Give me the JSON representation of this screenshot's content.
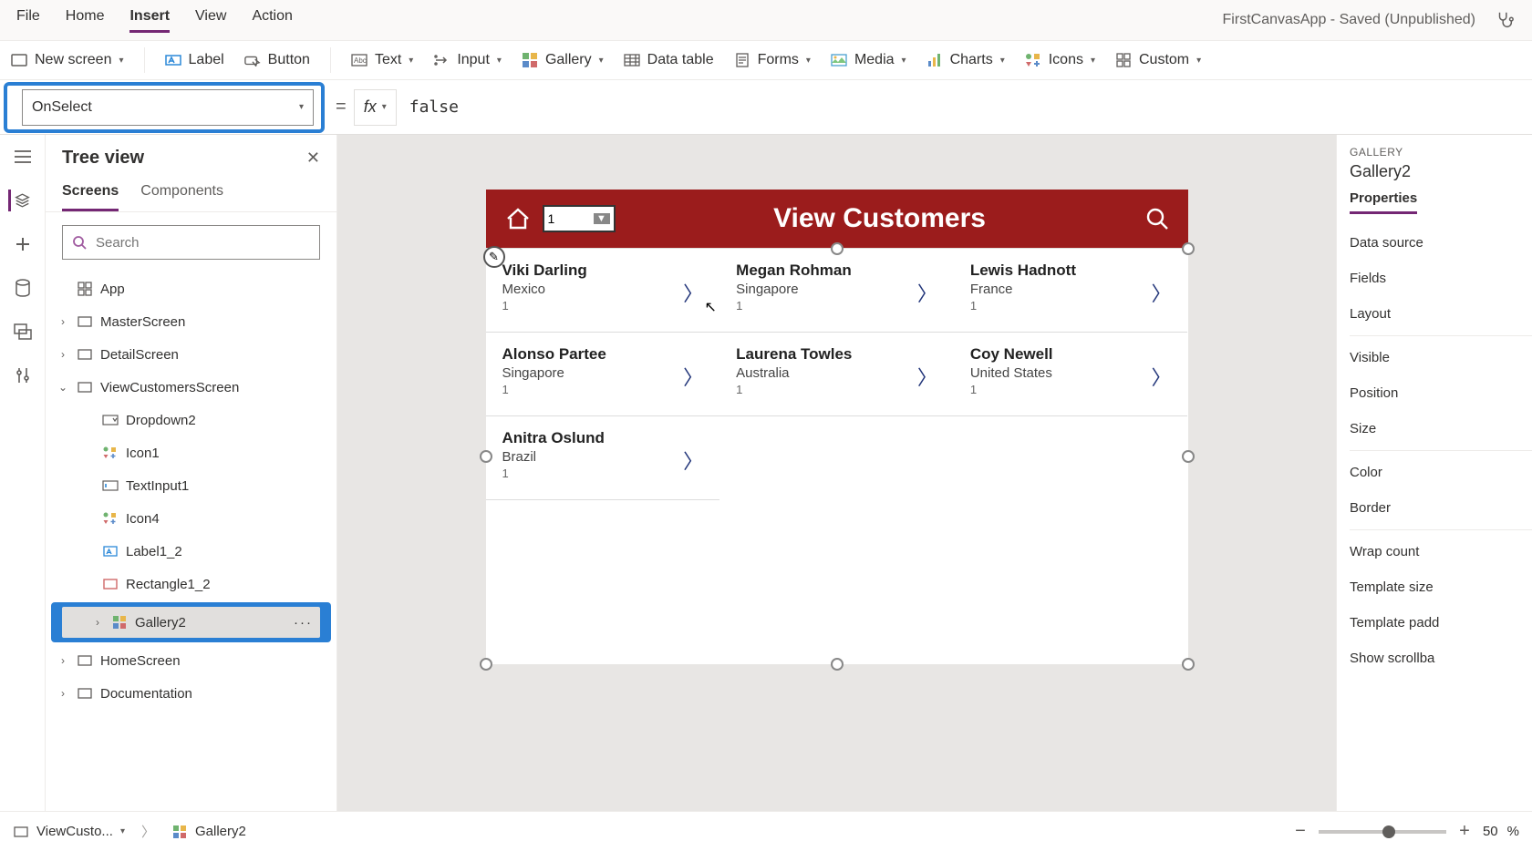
{
  "topmenu": {
    "items": [
      "File",
      "Home",
      "Insert",
      "View",
      "Action"
    ],
    "active_index": 2,
    "status": "FirstCanvasApp - Saved (Unpublished)"
  },
  "ribbon": {
    "new_screen": "New screen",
    "label": "Label",
    "button": "Button",
    "text": "Text",
    "input": "Input",
    "gallery": "Gallery",
    "data_table": "Data table",
    "forms": "Forms",
    "media": "Media",
    "charts": "Charts",
    "icons": "Icons",
    "custom": "Custom"
  },
  "formula": {
    "property": "OnSelect",
    "equals": "=",
    "fx": "fx",
    "value": "false"
  },
  "treeview": {
    "title": "Tree view",
    "tabs": [
      "Screens",
      "Components"
    ],
    "active_tab": 0,
    "search_placeholder": "Search",
    "app_label": "App",
    "items": [
      {
        "label": "MasterScreen",
        "icon": "screen",
        "depth": 0,
        "expandable": true
      },
      {
        "label": "DetailScreen",
        "icon": "screen",
        "depth": 0,
        "expandable": true
      },
      {
        "label": "ViewCustomersScreen",
        "icon": "screen",
        "depth": 0,
        "expandable": true,
        "expanded": true
      },
      {
        "label": "Dropdown2",
        "icon": "dropdown",
        "depth": 1
      },
      {
        "label": "Icon1",
        "icon": "iconctrl",
        "depth": 1
      },
      {
        "label": "TextInput1",
        "icon": "textinput",
        "depth": 1
      },
      {
        "label": "Icon4",
        "icon": "iconctrl",
        "depth": 1
      },
      {
        "label": "Label1_2",
        "icon": "label",
        "depth": 1
      },
      {
        "label": "Rectangle1_2",
        "icon": "rect",
        "depth": 1
      },
      {
        "label": "Gallery2",
        "icon": "gallery",
        "depth": 1,
        "selected": true,
        "expandable": true
      },
      {
        "label": "HomeScreen",
        "icon": "screen",
        "depth": 0,
        "expandable": true
      },
      {
        "label": "Documentation",
        "icon": "screen",
        "depth": 0,
        "expandable": true
      }
    ]
  },
  "canvas": {
    "header_title": "View Customers",
    "dropdown_value": "1",
    "customers": [
      {
        "name": "Viki  Darling",
        "country": "Mexico",
        "num": "1"
      },
      {
        "name": "Megan  Rohman",
        "country": "Singapore",
        "num": "1"
      },
      {
        "name": "Lewis  Hadnott",
        "country": "France",
        "num": "1"
      },
      {
        "name": "Alonso  Partee",
        "country": "Singapore",
        "num": "1"
      },
      {
        "name": "Laurena  Towles",
        "country": "Australia",
        "num": "1"
      },
      {
        "name": "Coy  Newell",
        "country": "United States",
        "num": "1"
      },
      {
        "name": "Anitra  Oslund",
        "country": "Brazil",
        "num": "1"
      }
    ]
  },
  "properties": {
    "category": "GALLERY",
    "name": "Gallery2",
    "tab": "Properties",
    "rows": [
      "Data source",
      "Fields",
      "Layout",
      "—",
      "Visible",
      "Position",
      "Size",
      "—",
      "Color",
      "Border",
      "—",
      "Wrap count",
      "Template size",
      "Template padd",
      "Show scrollba"
    ]
  },
  "bottombar": {
    "screen": "ViewCusto...",
    "selection": "Gallery2",
    "zoom": "50",
    "zoom_unit": "%"
  }
}
